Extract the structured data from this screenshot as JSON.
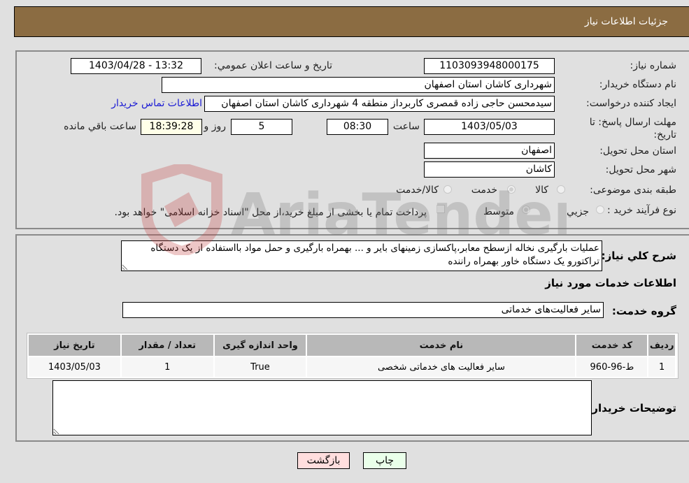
{
  "header": {
    "title": "جزئیات اطلاعات نیاز"
  },
  "form": {
    "need_number": {
      "label": "شماره نیاز:",
      "value": "1103093948000175"
    },
    "announce_datetime": {
      "label": "تاریخ و ساعت اعلان عمومي:",
      "value": "1403/04/28 - 13:32"
    },
    "buyer_org": {
      "label": "نام دستگاه خريدار:",
      "value": "شهرداری کاشان استان اصفهان"
    },
    "requester": {
      "label": "ایجاد کننده درخواست:",
      "value": "سیدمحسن حاجی زاده قمصری کاربرداز منطقه 4 شهرداری کاشان استان اصفهان",
      "contact_link": "اطلاعات تماس خریدار"
    },
    "deadline": {
      "label": "مهلت ارسال پاسخ: تا تاریخ:",
      "date": "1403/05/03",
      "time_label": "ساعت",
      "time": "08:30",
      "days": "5",
      "days_label": "روز و",
      "remaining": "18:39:28",
      "remaining_label": "ساعت باقي مانده"
    },
    "province": {
      "label": "استان محل تحویل:",
      "value": "اصفهان"
    },
    "city": {
      "label": "شهر محل تحویل:",
      "value": "کاشان"
    },
    "category": {
      "label": "طبقه بندی موضوعی:",
      "options": [
        {
          "label": "کالا",
          "selected": false
        },
        {
          "label": "خدمت",
          "selected": true
        },
        {
          "label": "کالا/خدمت",
          "selected": false
        }
      ]
    },
    "purchase_type": {
      "label": "نوع فرآیند خرید :",
      "options": [
        {
          "label": "جزيي",
          "selected": false
        },
        {
          "label": "متوسط",
          "selected": true
        }
      ],
      "treasury_note": "پرداخت تمام یا بخشی از مبلغ خرید،از محل \"اسناد خزانه اسلامی\" خواهد بود."
    }
  },
  "description": {
    "label": "شرح کلي نياز:",
    "value": "عملیات بارگیری نخاله ازسطح معابر،پاکسازی زمینهای بایر و ... بهمراه بارگیری و حمل مواد بااستفاده از یک دستگاه تراکتورو یک دستگاه خاور بهمراه راننده"
  },
  "services_section": {
    "title": "اطلاعات خدمات مورد نیاز",
    "group_label": "گروه خدمت:",
    "group_value": "سایر فعالیت‌های خدماتی",
    "table": {
      "columns": [
        "ردیف",
        "کد خدمت",
        "نام خدمت",
        "واحد اندازه گیری",
        "تعداد / مقدار",
        "تاریخ نیاز"
      ],
      "rows": [
        [
          "1",
          "ط-96-960",
          "سایر فعالیت های خدماتی شخصی",
          "True",
          "1",
          "1403/05/03"
        ]
      ]
    }
  },
  "buyer_notes": {
    "label": "توضیحات خریدار:",
    "value": ""
  },
  "buttons": {
    "print": "چاپ",
    "back": "بازگشت"
  },
  "watermark": {
    "text": "AriaTender.neT"
  },
  "colors": {
    "header_bg": "#8b6c42",
    "link": "#1a1ad4",
    "print_bg": "#eaffea",
    "back_bg": "#ffdede",
    "remaining_bg": "#ffffe8"
  }
}
